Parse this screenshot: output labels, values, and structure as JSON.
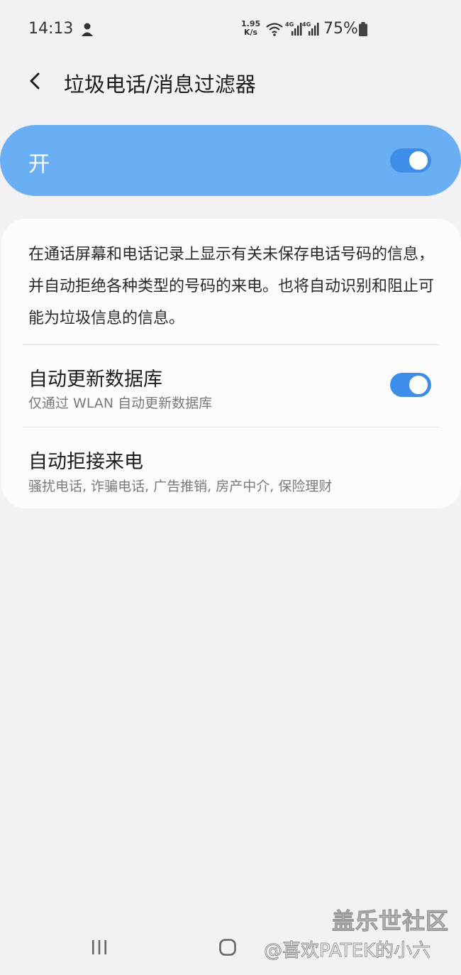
{
  "status_bar": {
    "time": "14:13",
    "notification_icon": "user-shield-icon",
    "net_speed_value": "1.95",
    "net_speed_unit": "K/s",
    "wifi_icon": "wifi-icon",
    "signal_1_label": "4G",
    "signal_2_label": "4G",
    "battery_percent": "75%",
    "battery_icon": "battery-icon"
  },
  "header": {
    "back_icon": "chevron-left-icon",
    "title": "垃圾电话/消息过滤器"
  },
  "master_switch": {
    "label": "开",
    "state": "on"
  },
  "settings": {
    "description": "在通话屏幕和电话记录上显示有关未保存电话号码的信息，并自动拒绝各种类型的号码的来电。也将自动识别和阻止可能为垃圾信息的信息。",
    "items": [
      {
        "title": "自动更新数据库",
        "subtitle": "仅通过 WLAN 自动更新数据库",
        "toggle_state": "on"
      },
      {
        "title": "自动拒接来电",
        "subtitle": "骚扰电话, 诈骗电话, 广告推销, 房产中介, 保险理财"
      }
    ]
  },
  "watermark": {
    "logo_text": "盖乐世社区",
    "user_text": "@喜欢PATEK的小六"
  },
  "nav_bar": {
    "recent_icon": "recent-apps-icon",
    "home_icon": "home-icon"
  },
  "colors": {
    "accent": "#3e8de8",
    "master_card": "#6aaff3",
    "background": "#f2f2f4",
    "card": "#fcfcfc"
  }
}
